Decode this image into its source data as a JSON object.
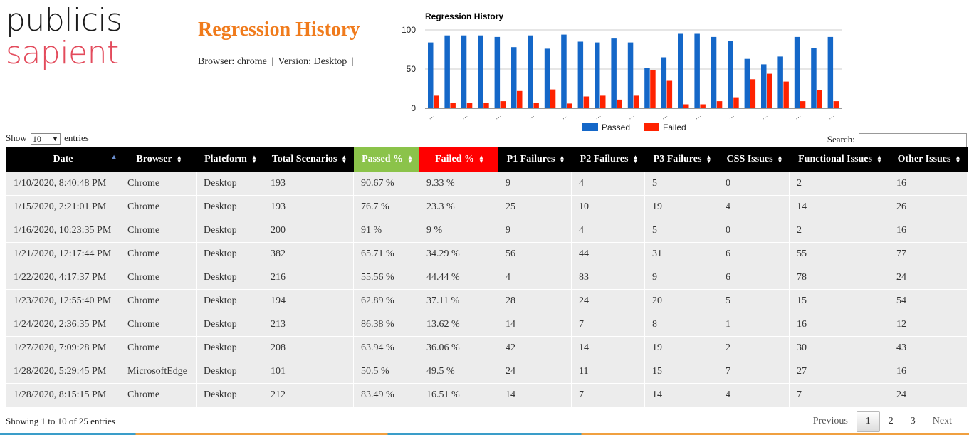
{
  "logo": {
    "line1": "publicis",
    "line2": "sapient"
  },
  "page": {
    "title": "Regression History",
    "browser_label": "Browser: chrome",
    "version_label": "Version: Desktop",
    "sep": "|"
  },
  "chart_data": {
    "type": "bar",
    "title": "Regression History",
    "ylim": [
      0,
      100
    ],
    "yticks": [
      0,
      50,
      100
    ],
    "legend_position": "bottom",
    "grid": true,
    "categories": [
      "…",
      "…",
      "…",
      "…",
      "…",
      "…",
      "…",
      "…",
      "…",
      "…",
      "…",
      "…",
      "…",
      "…",
      "…",
      "…",
      "…",
      "…",
      "…",
      "…",
      "…",
      "…",
      "…",
      "…",
      "…"
    ],
    "series": [
      {
        "name": "Passed",
        "color": "#1467c8",
        "values": [
          84,
          93,
          93,
          93,
          91,
          78,
          93,
          76,
          94,
          85,
          84,
          89,
          84,
          51,
          65,
          95,
          95,
          91,
          86,
          63,
          56,
          66,
          91,
          77,
          91
        ]
      },
      {
        "name": "Failed",
        "color": "#ff2200",
        "values": [
          16,
          7,
          7,
          7,
          9,
          22,
          7,
          24,
          6,
          15,
          16,
          11,
          16,
          49,
          35,
          5,
          5,
          9,
          14,
          37,
          44,
          34,
          9,
          23,
          9
        ]
      }
    ]
  },
  "controls": {
    "show_label": "Show",
    "page_size": "10",
    "entries_label": "entries",
    "search_label": "Search:",
    "search_value": ""
  },
  "table": {
    "columns": [
      "Date",
      "Browser",
      "Plateform",
      "Total Scenarios",
      "Passed %",
      "Failed %",
      "P1 Failures",
      "P2 Failures",
      "P3 Failures",
      "CSS Issues",
      "Functional Issues",
      "Other Issues"
    ],
    "rows": [
      [
        "1/10/2020, 8:40:48 PM",
        "Chrome",
        "Desktop",
        "193",
        "90.67 %",
        "9.33 %",
        "9",
        "4",
        "5",
        "0",
        "2",
        "16"
      ],
      [
        "1/15/2020, 2:21:01 PM",
        "Chrome",
        "Desktop",
        "193",
        "76.7 %",
        "23.3 %",
        "25",
        "10",
        "19",
        "4",
        "14",
        "26"
      ],
      [
        "1/16/2020, 10:23:35 PM",
        "Chrome",
        "Desktop",
        "200",
        "91 %",
        "9 %",
        "9",
        "4",
        "5",
        "0",
        "2",
        "16"
      ],
      [
        "1/21/2020, 12:17:44 PM",
        "Chrome",
        "Desktop",
        "382",
        "65.71 %",
        "34.29 %",
        "56",
        "44",
        "31",
        "6",
        "55",
        "77"
      ],
      [
        "1/22/2020, 4:17:37 PM",
        "Chrome",
        "Desktop",
        "216",
        "55.56 %",
        "44.44 %",
        "4",
        "83",
        "9",
        "6",
        "78",
        "24"
      ],
      [
        "1/23/2020, 12:55:40 PM",
        "Chrome",
        "Desktop",
        "194",
        "62.89 %",
        "37.11 %",
        "28",
        "24",
        "20",
        "5",
        "15",
        "54"
      ],
      [
        "1/24/2020, 2:36:35 PM",
        "Chrome",
        "Desktop",
        "213",
        "86.38 %",
        "13.62 %",
        "14",
        "7",
        "8",
        "1",
        "16",
        "12"
      ],
      [
        "1/27/2020, 7:09:28 PM",
        "Chrome",
        "Desktop",
        "208",
        "63.94 %",
        "36.06 %",
        "42",
        "14",
        "19",
        "2",
        "30",
        "43"
      ],
      [
        "1/28/2020, 5:29:45 PM",
        "MicrosoftEdge",
        "Desktop",
        "101",
        "50.5 %",
        "49.5 %",
        "24",
        "11",
        "15",
        "7",
        "27",
        "16"
      ],
      [
        "1/28/2020, 8:15:15 PM",
        "Chrome",
        "Desktop",
        "212",
        "83.49 %",
        "16.51 %",
        "14",
        "7",
        "14",
        "4",
        "7",
        "24"
      ]
    ]
  },
  "footer": {
    "status": "Showing 1 to 10 of 25 entries",
    "previous": "Previous",
    "next": "Next",
    "pages": [
      "1",
      "2",
      "3"
    ],
    "current_page": "1"
  },
  "icons": {
    "sort": "sort-both-icon",
    "sort_asc": "sort-asc-icon",
    "dropdown": "chevron-down-icon"
  }
}
